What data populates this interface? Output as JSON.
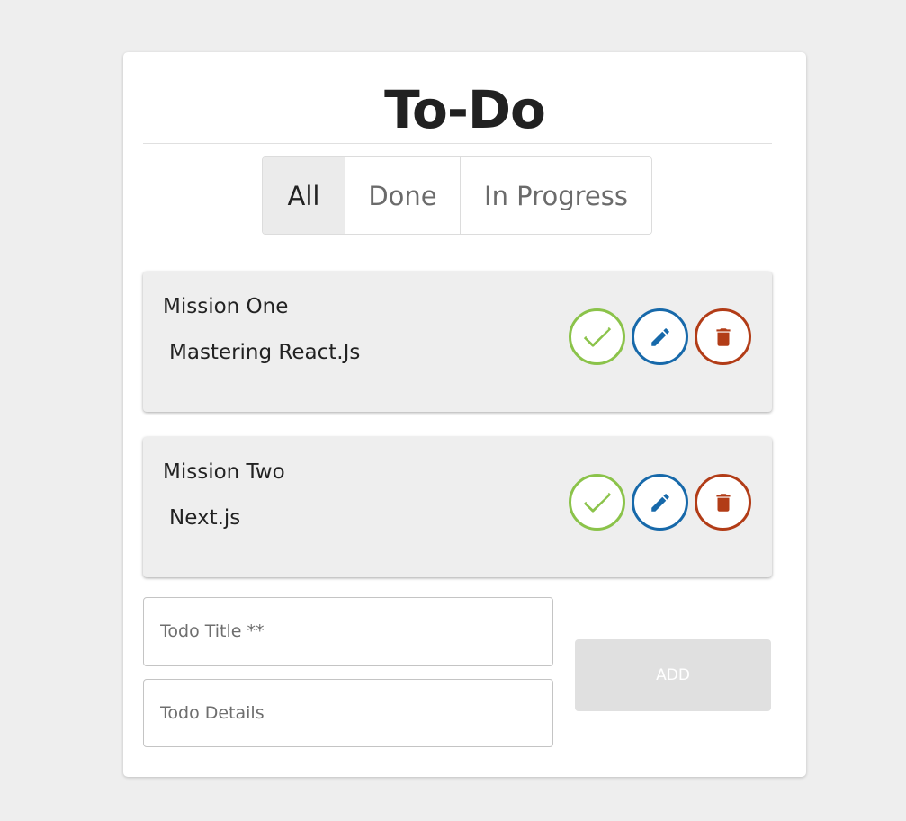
{
  "header": {
    "title": "To-Do"
  },
  "filters": [
    {
      "label": "All",
      "selected": true
    },
    {
      "label": "Done",
      "selected": false
    },
    {
      "label": "In Progress",
      "selected": false
    }
  ],
  "todos": [
    {
      "title": "Mission One",
      "details": "Mastering React.Js"
    },
    {
      "title": "Mission Two",
      "details": "Next.js"
    }
  ],
  "form": {
    "title_placeholder": "Todo Title **",
    "title_value": "",
    "details_placeholder": "Todo Details",
    "details_value": "",
    "add_label": "ADD"
  },
  "icons": {
    "check": "check-icon",
    "edit": "pencil-icon",
    "delete": "trash-icon"
  },
  "colors": {
    "check": "#8bc34a",
    "edit": "#1769aa",
    "delete": "#b23c17"
  }
}
